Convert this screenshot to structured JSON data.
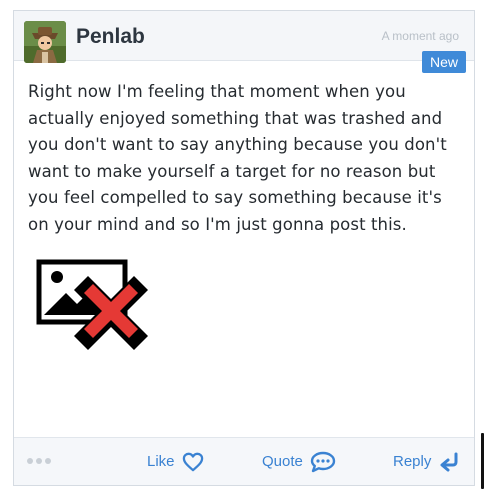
{
  "post": {
    "author": "Penlab",
    "timestamp": "A moment ago",
    "badge": "New",
    "body": "Right now I'm feeling that moment when you\nactually enjoyed something that was trashed and\nyou don't want to say anything because you don't\nwant to make yourself a target for no reason but\nyou feel compelled to say something because it's\non your mind and so I'm just gonna post this.",
    "image_state": "broken-image"
  },
  "actions": {
    "like_label": "Like",
    "quote_label": "Quote",
    "reply_label": "Reply"
  },
  "icons": {
    "like": "heart-icon",
    "quote": "speech-bubble-icon",
    "reply": "reply-arrow-icon",
    "more": "more-options-icon",
    "broken_image": "broken-image-icon"
  },
  "colors": {
    "accent": "#3a82d2",
    "badge": "#3f8ad8",
    "header_bg": "#f4f6f9",
    "footer_bg": "#f5f7fa",
    "broken_x": "#e53935"
  }
}
